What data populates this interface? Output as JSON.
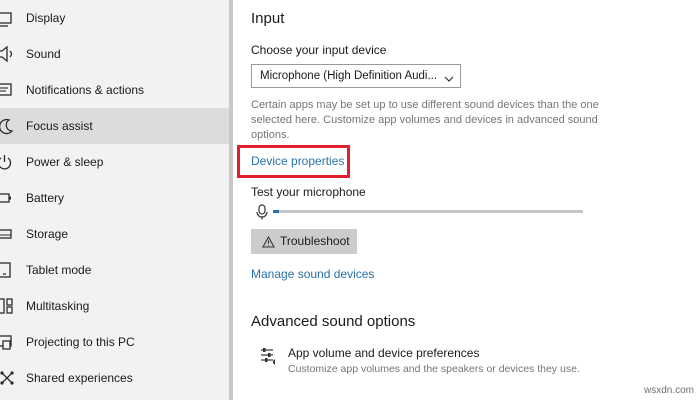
{
  "sidebar": {
    "items": [
      {
        "label": "Display",
        "icon": "display-icon"
      },
      {
        "label": "Sound",
        "icon": "speaker-icon"
      },
      {
        "label": "Notifications & actions",
        "icon": "notifications-icon"
      },
      {
        "label": "Focus assist",
        "icon": "moon-icon",
        "active": true
      },
      {
        "label": "Power & sleep",
        "icon": "power-icon"
      },
      {
        "label": "Battery",
        "icon": "battery-icon"
      },
      {
        "label": "Storage",
        "icon": "storage-icon"
      },
      {
        "label": "Tablet mode",
        "icon": "tablet-icon"
      },
      {
        "label": "Multitasking",
        "icon": "multitasking-icon"
      },
      {
        "label": "Projecting to this PC",
        "icon": "projecting-icon"
      },
      {
        "label": "Shared experiences",
        "icon": "shared-experiences-icon"
      }
    ]
  },
  "input": {
    "heading": "Input",
    "device_label": "Choose your input device",
    "device_value": "Microphone (High Definition Audi...",
    "description": "Certain apps may be set up to use different sound devices than the one selected here. Customize app volumes and devices in advanced sound options.",
    "device_properties_link": "Device properties",
    "test_label": "Test your microphone",
    "mic_level": 0.02,
    "troubleshoot_label": "Troubleshoot",
    "manage_link": "Manage sound devices"
  },
  "advanced": {
    "heading": "Advanced sound options",
    "pref_title": "App volume and device preferences",
    "pref_sub": "Customize app volumes and the speakers or devices they use."
  },
  "watermark": "wsxdn.com",
  "colors": {
    "accent": "#2a72a8",
    "highlight": "#e0202a",
    "sidebar_bg": "#f2f2f2",
    "sidebar_active": "#dcdcdc"
  }
}
